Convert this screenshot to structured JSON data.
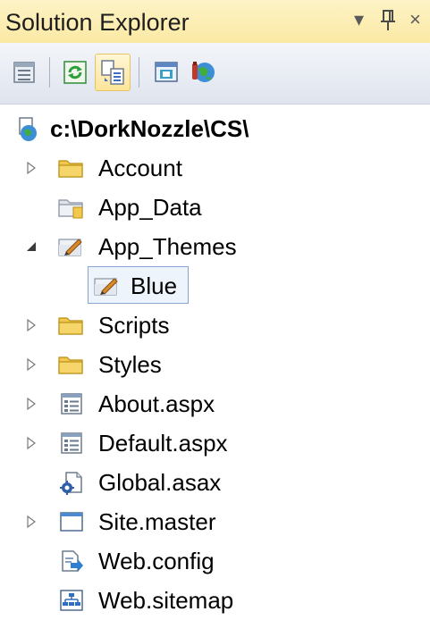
{
  "panel": {
    "title": "Solution Explorer",
    "dropdown_glyph": "▾",
    "pin_glyph": "ᛘ",
    "close_glyph": "×"
  },
  "toolbar": {
    "buttons": [
      {
        "icon": "properties-icon"
      },
      {
        "icon": "refresh-icon"
      },
      {
        "icon": "show-all-files-icon",
        "active": true
      },
      {
        "icon": "view-designer-icon"
      },
      {
        "icon": "copy-website-icon"
      }
    ]
  },
  "tree": {
    "root": {
      "label": "c:\\DorkNozzle\\CS\\",
      "icon": "web-project-icon"
    },
    "items": [
      {
        "label": "Account",
        "icon": "folder-icon",
        "expander": "collapsed"
      },
      {
        "label": "App_Data",
        "icon": "app-data-folder-icon",
        "expander": "none"
      },
      {
        "label": "App_Themes",
        "icon": "theme-folder-icon",
        "expander": "expanded"
      },
      {
        "label": "Blue",
        "icon": "theme-folder-icon",
        "expander": "none",
        "selected": true
      },
      {
        "label": "Scripts",
        "icon": "folder-icon",
        "expander": "collapsed"
      },
      {
        "label": "Styles",
        "icon": "folder-icon",
        "expander": "collapsed"
      },
      {
        "label": "About.aspx",
        "icon": "aspx-page-icon",
        "expander": "collapsed"
      },
      {
        "label": "Default.aspx",
        "icon": "aspx-page-icon",
        "expander": "collapsed"
      },
      {
        "label": "Global.asax",
        "icon": "global-asax-icon",
        "expander": "none"
      },
      {
        "label": "Site.master",
        "icon": "master-page-icon",
        "expander": "collapsed"
      },
      {
        "label": "Web.config",
        "icon": "config-file-icon",
        "expander": "none"
      },
      {
        "label": "Web.sitemap",
        "icon": "sitemap-icon",
        "expander": "none"
      }
    ]
  },
  "colors": {
    "title_bg": "#fbe9a4",
    "toolbar_bg": "#dfe4ee",
    "selection_border": "#88a4d1",
    "folder": "#f2c94c"
  }
}
